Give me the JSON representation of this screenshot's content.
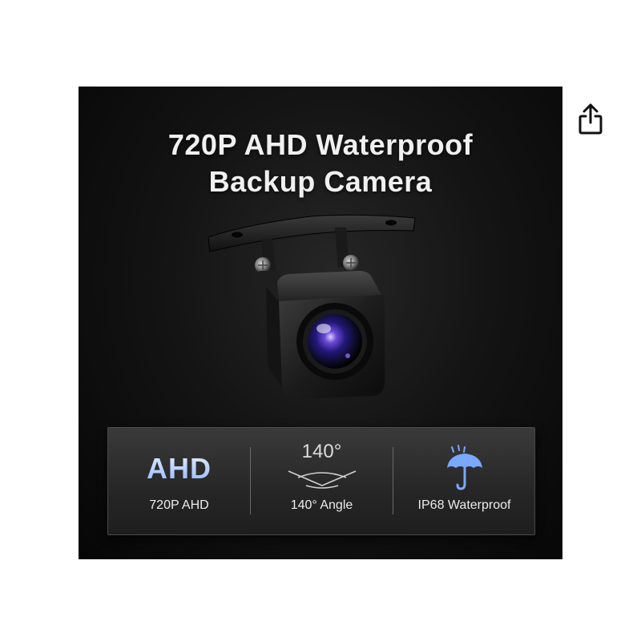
{
  "header": {
    "share_icon": "share-icon"
  },
  "product": {
    "headline_line1": "720P AHD Waterproof",
    "headline_line2": "Backup Camera",
    "features": [
      {
        "icon": "ahd-logo",
        "glyph_text": "AHD",
        "label": "720P AHD"
      },
      {
        "icon": "angle-icon",
        "glyph_text": "140°",
        "label": "140° Angle"
      },
      {
        "icon": "umbrella-icon",
        "label": "IP68 Waterproof"
      }
    ]
  },
  "colors": {
    "accent_blue": "#7aa8ff",
    "background": "#111111"
  }
}
